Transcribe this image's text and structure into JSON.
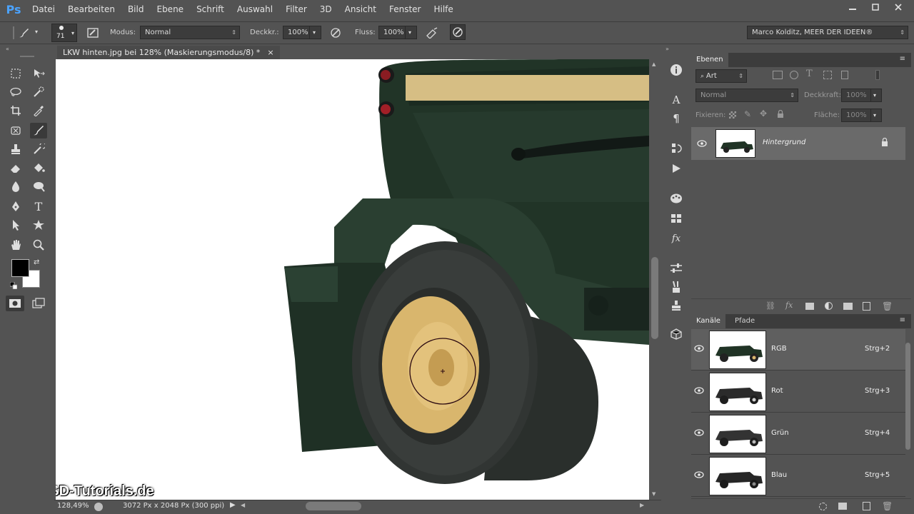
{
  "app": {
    "logo": "Ps"
  },
  "menu": [
    "Datei",
    "Bearbeiten",
    "Bild",
    "Ebene",
    "Schrift",
    "Auswahl",
    "Filter",
    "3D",
    "Ansicht",
    "Fenster",
    "Hilfe"
  ],
  "options": {
    "brush_size": "71",
    "mode_label": "Modus:",
    "mode_value": "Normal",
    "opacity_label": "Deckkr.:",
    "opacity_value": "100%",
    "flow_label": "Fluss:",
    "flow_value": "100%",
    "workspace": "Marco Kolditz, MEER DER IDEEN®"
  },
  "document": {
    "tab_title": "LKW hinten.jpg bei 128% (Maskierungsmodus/8) *",
    "close": "×",
    "zoom": "128,49%",
    "doc_info": "3072 Px x 2048 Px (300 ppi)"
  },
  "watermark": "PSD-Tutorials.de",
  "layers_panel": {
    "tab": "Ebenen",
    "filter_kind": "Art",
    "blend_mode": "Normal",
    "opacity_label": "Deckkraft:",
    "opacity_value": "100%",
    "lock_label": "Fixieren:",
    "fill_label": "Fläche:",
    "fill_value": "100%",
    "layers": [
      {
        "name": "Hintergrund"
      }
    ]
  },
  "channels_panel": {
    "tabs": [
      "Kanäle",
      "Pfade"
    ],
    "channels": [
      {
        "name": "RGB",
        "shortcut": "Strg+2"
      },
      {
        "name": "Rot",
        "shortcut": "Strg+3"
      },
      {
        "name": "Grün",
        "shortcut": "Strg+4"
      },
      {
        "name": "Blau",
        "shortcut": "Strg+5"
      }
    ]
  },
  "colors": {
    "foreground": "#000000",
    "background": "#ffffff",
    "truck_green": "#223529",
    "wheel_rim": "#d9b66d",
    "accent_blue": "#4ba3ff"
  }
}
